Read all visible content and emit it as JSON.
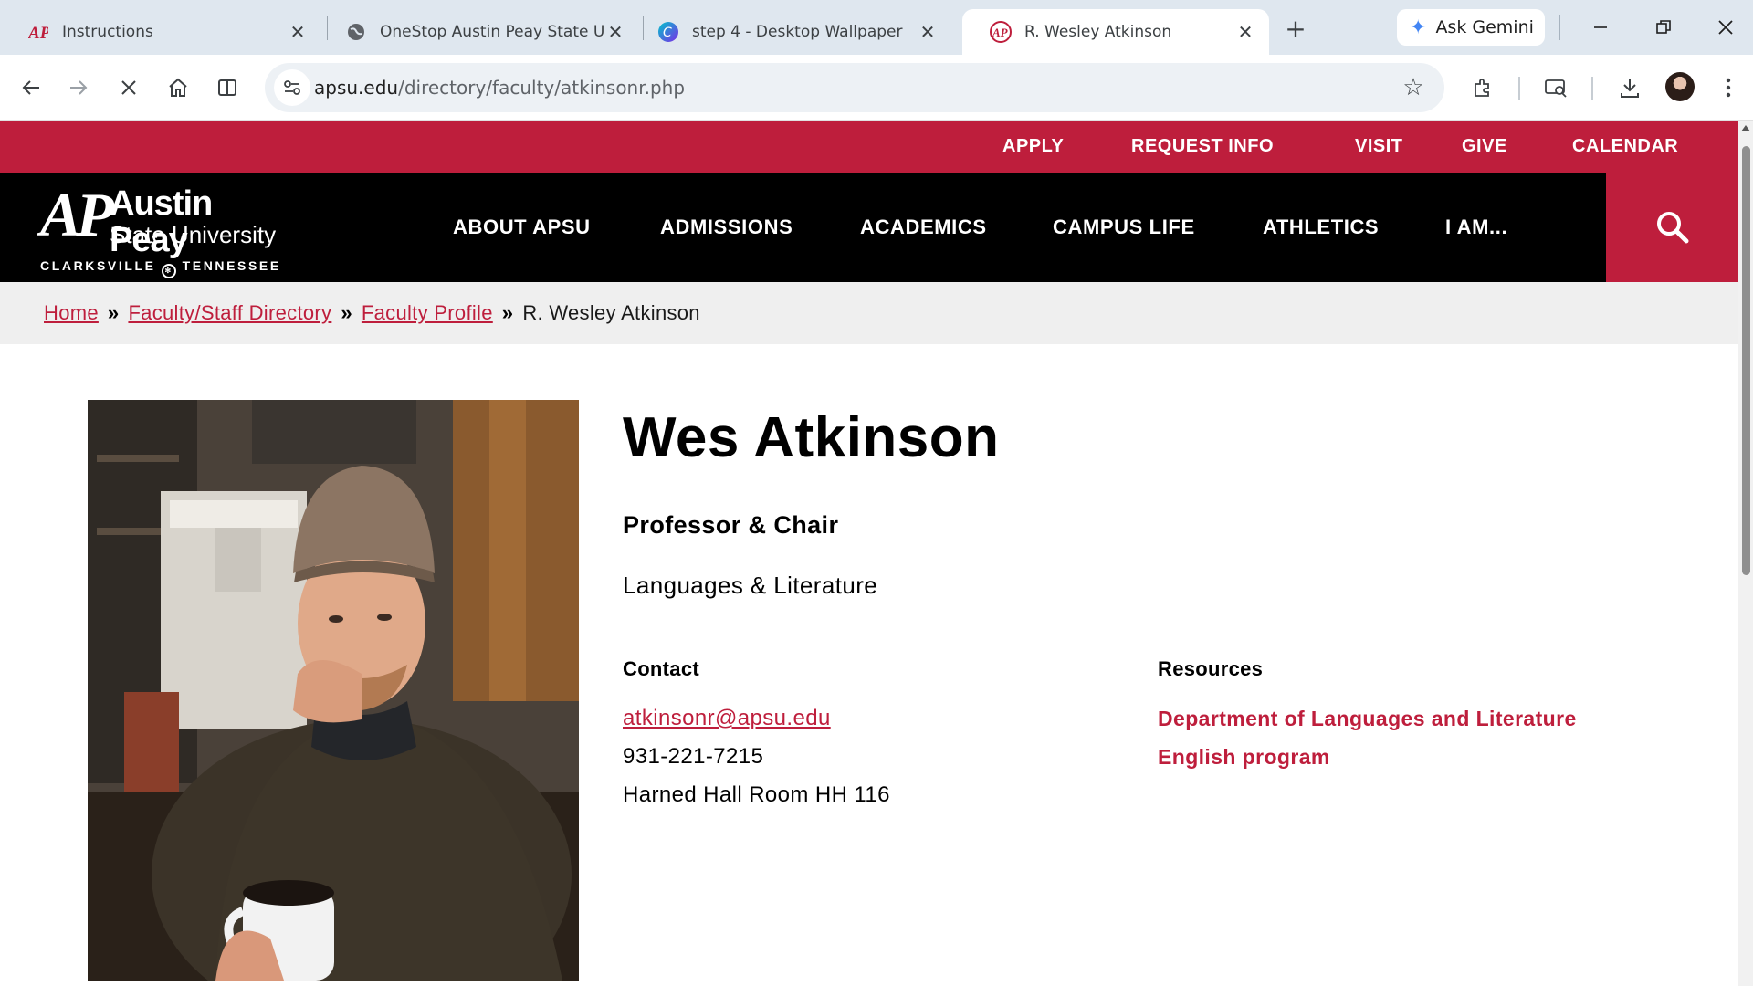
{
  "browser": {
    "tabs": [
      {
        "title": "Instructions",
        "icon": "apsu-logo-icon"
      },
      {
        "title": "OneStop Austin Peay State University",
        "icon": "globe-icon"
      },
      {
        "title": "step 4 - Desktop Wallpaper",
        "icon": "canva-icon"
      },
      {
        "title": "R. Wesley Atkinson",
        "icon": "apsu-logo-icon",
        "active": true
      }
    ],
    "gemini_label": "Ask Gemini",
    "url_host": "apsu.edu",
    "url_path": "/directory/faculty/atkinsonr.php"
  },
  "site": {
    "accent": "#be1e3c",
    "utility_links": [
      "APPLY",
      "REQUEST INFO",
      "VISIT",
      "GIVE",
      "CALENDAR"
    ],
    "logo": {
      "mark": "AP",
      "line1": "Austin Peay",
      "line2": "State University",
      "line3_left": "CLARKSVILLE",
      "line3_right": "TENNESSEE"
    },
    "nav": [
      "ABOUT APSU",
      "ADMISSIONS",
      "ACADEMICS",
      "CAMPUS LIFE",
      "ATHLETICS",
      "I AM..."
    ],
    "breadcrumb": {
      "home": "Home",
      "directory": "Faculty/Staff Directory",
      "profile": "Faculty Profile",
      "current": "R. Wesley Atkinson",
      "separator": "»"
    }
  },
  "profile": {
    "name": "Wes Atkinson",
    "title": "Professor & Chair",
    "department": "Languages & Literature",
    "contact_heading": "Contact",
    "email": "atkinsonr@apsu.edu",
    "phone": "931-221-7215",
    "office": "Harned Hall Room HH 116",
    "resources_heading": "Resources",
    "resources": [
      "Department of Languages and Literature",
      "English program"
    ]
  }
}
